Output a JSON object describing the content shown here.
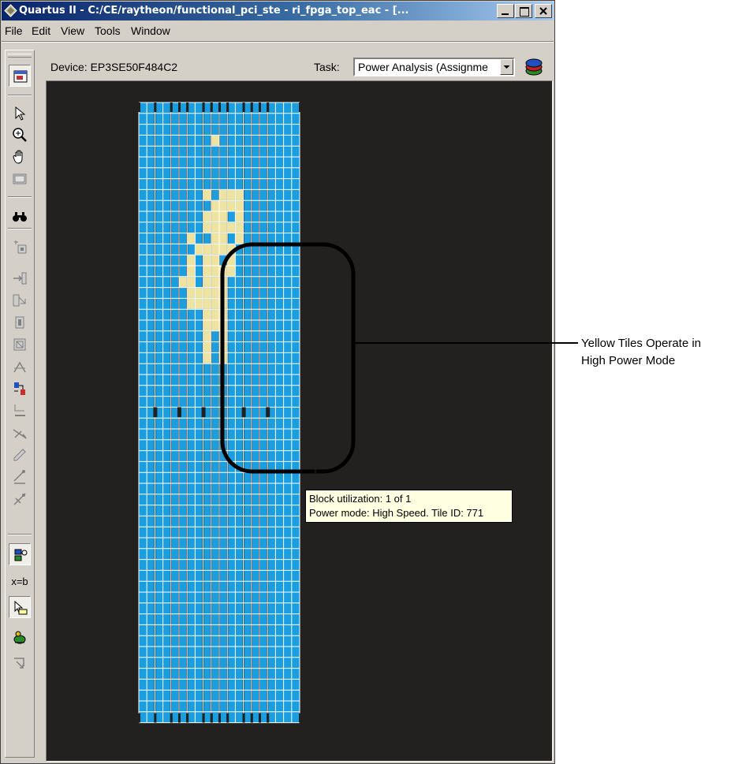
{
  "window": {
    "title": "Quartus II - C:/CE/raytheon/functional_pci_ste - ri_fpga_top_eac - [..."
  },
  "menu": {
    "items": [
      "File",
      "Edit",
      "View",
      "Tools",
      "Window"
    ]
  },
  "toolbar": {
    "device_label": "Device: EP3SE50F484C2",
    "task_label": "Task:",
    "task_value": "Power Analysis (Assignme",
    "layers_icon": "layers-icon"
  },
  "tools": [
    {
      "name": "floorplan-view-icon",
      "selected": true
    },
    {
      "name": "selection-arrow-icon",
      "selected": false
    },
    {
      "name": "zoom-icon",
      "selected": false
    },
    {
      "name": "hand-pan-icon",
      "selected": false
    },
    {
      "name": "fit-window-icon",
      "selected": false
    },
    {
      "name": "find-binoculars-icon",
      "selected": false
    },
    {
      "name": "assign-icon",
      "selected": false
    },
    {
      "name": "pin-assign-icon",
      "selected": false
    },
    {
      "name": "fanin-icon",
      "selected": false
    },
    {
      "name": "fanout-icon",
      "selected": false
    },
    {
      "name": "region-icon",
      "selected": false
    },
    {
      "name": "routing-icon",
      "selected": false
    },
    {
      "name": "connections-icon",
      "selected": false
    },
    {
      "name": "delay-icon",
      "selected": false
    },
    {
      "name": "path-icon",
      "selected": false
    },
    {
      "name": "pencil-icon",
      "selected": false
    },
    {
      "name": "paths-icon",
      "selected": false
    },
    {
      "name": "clear-icon",
      "selected": false
    },
    {
      "name": "power-view-icon",
      "selected": true
    },
    {
      "name": "equation-icon",
      "label": "x=b",
      "selected": false
    },
    {
      "name": "layer-settings-icon",
      "selected": true
    },
    {
      "name": "bird-eye-icon",
      "selected": false
    },
    {
      "name": "export-icon",
      "selected": false
    }
  ],
  "tooltip": {
    "line1": "Block utilization: 1 of 1",
    "line2": "Power mode: High Speed. Tile ID: 771"
  },
  "annotation": {
    "line1": "Yellow Tiles Operate in",
    "line2": "High Power Mode"
  },
  "colors": {
    "low_power_tile": "#1a9ee0",
    "high_power_tile": "#efe3a0",
    "canvas_bg": "#222120",
    "callout": "#000000"
  },
  "floorplan": {
    "high_power_tiles": [
      [
        8,
        8
      ],
      [
        10,
        8
      ],
      [
        11,
        8
      ],
      [
        12,
        8
      ],
      [
        9,
        9
      ],
      [
        10,
        9
      ],
      [
        11,
        9
      ],
      [
        12,
        9
      ],
      [
        8,
        10
      ],
      [
        9,
        10
      ],
      [
        10,
        10
      ],
      [
        12,
        10
      ],
      [
        8,
        11
      ],
      [
        9,
        11
      ],
      [
        10,
        11
      ],
      [
        11,
        11
      ],
      [
        12,
        11
      ],
      [
        6,
        12
      ],
      [
        9,
        12
      ],
      [
        10,
        12
      ],
      [
        12,
        12
      ],
      [
        7,
        13
      ],
      [
        8,
        13
      ],
      [
        9,
        13
      ],
      [
        10,
        13
      ],
      [
        11,
        13
      ],
      [
        6,
        14
      ],
      [
        8,
        14
      ],
      [
        9,
        14
      ],
      [
        11,
        14
      ],
      [
        6,
        15
      ],
      [
        8,
        15
      ],
      [
        9,
        15
      ],
      [
        10,
        15
      ],
      [
        11,
        15
      ],
      [
        5,
        16
      ],
      [
        6,
        16
      ],
      [
        8,
        16
      ],
      [
        9,
        16
      ],
      [
        10,
        16
      ],
      [
        6,
        17
      ],
      [
        7,
        17
      ],
      [
        8,
        17
      ],
      [
        9,
        17
      ],
      [
        10,
        17
      ],
      [
        6,
        18
      ],
      [
        7,
        18
      ],
      [
        8,
        18
      ],
      [
        9,
        18
      ],
      [
        10,
        18
      ],
      [
        8,
        19
      ],
      [
        9,
        19
      ],
      [
        10,
        19
      ],
      [
        8,
        20
      ],
      [
        9,
        20
      ],
      [
        10,
        20
      ],
      [
        8,
        21
      ],
      [
        10,
        21
      ],
      [
        8,
        22
      ],
      [
        10,
        22
      ],
      [
        8,
        23
      ],
      [
        10,
        23
      ],
      [
        9,
        3
      ]
    ]
  }
}
